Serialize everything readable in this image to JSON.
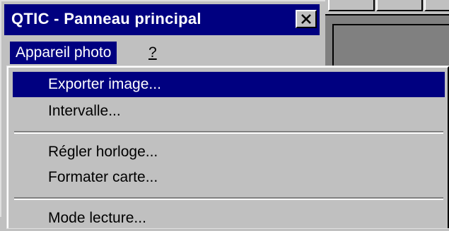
{
  "window": {
    "title": "QTIC - Panneau principal",
    "close_symbol": "×"
  },
  "menubar": {
    "items": [
      {
        "label": "Appareil photo",
        "active": true
      },
      {
        "label": "?",
        "active": false
      }
    ]
  },
  "dropdown": {
    "items": [
      {
        "label": "Exporter image...",
        "selected": true
      },
      {
        "label": "Intervalle...",
        "selected": false
      },
      {
        "label": "Régler horloge...",
        "selected": false
      },
      {
        "label": "Formater carte...",
        "selected": false
      },
      {
        "label": "Mode lecture...",
        "selected": false
      }
    ]
  },
  "colors": {
    "title_bar": "#000080",
    "face": "#c0c0c0",
    "highlight": "#000080",
    "desktop_gray": "#808080"
  },
  "icons": {
    "close": "close-icon"
  }
}
